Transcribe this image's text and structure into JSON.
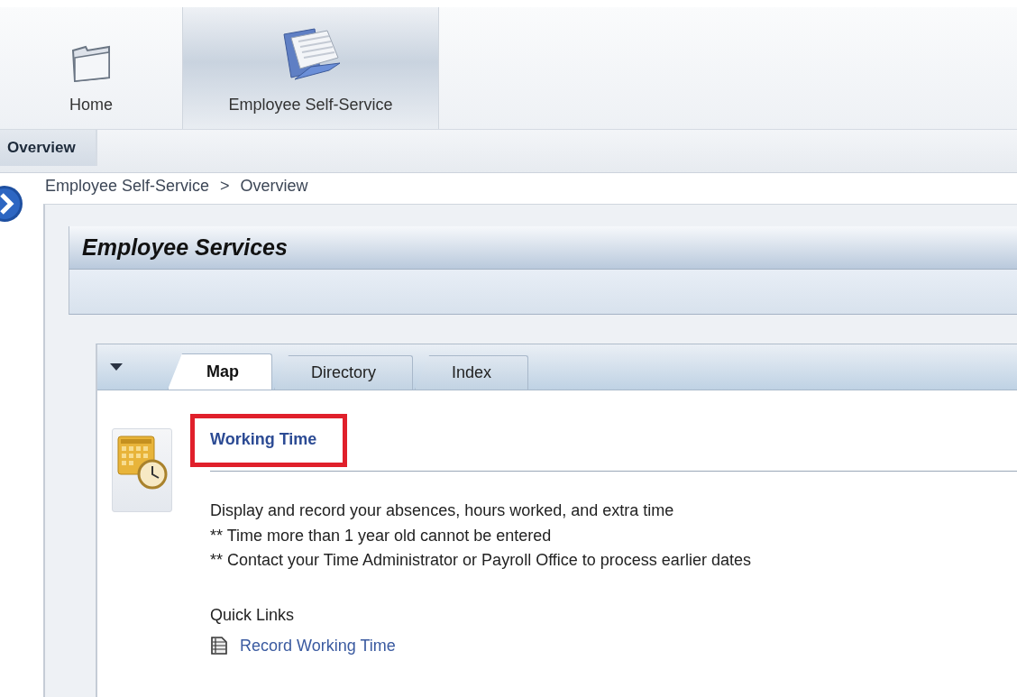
{
  "top_tabs": [
    {
      "label": "Home",
      "selected": false
    },
    {
      "label": "Employee Self-Service",
      "selected": true
    }
  ],
  "sub_tabs": [
    {
      "label": "Overview",
      "selected": true
    }
  ],
  "breadcrumb": {
    "items": [
      "Employee Self-Service",
      "Overview"
    ],
    "separator": ">"
  },
  "panel": {
    "title": "Employee Services"
  },
  "content_tabs": [
    {
      "label": "Map",
      "selected": true
    },
    {
      "label": "Directory",
      "selected": false
    },
    {
      "label": "Index",
      "selected": false
    }
  ],
  "service": {
    "title": "Working Time",
    "highlighted": true,
    "description": [
      "Display and record your absences, hours worked, and extra time",
      "** Time more than 1 year old cannot be entered",
      "** Contact your Time Administrator or Payroll Office to process earlier dates"
    ],
    "quick_links_label": "Quick Links",
    "quick_links": [
      "Record Working Time"
    ]
  }
}
